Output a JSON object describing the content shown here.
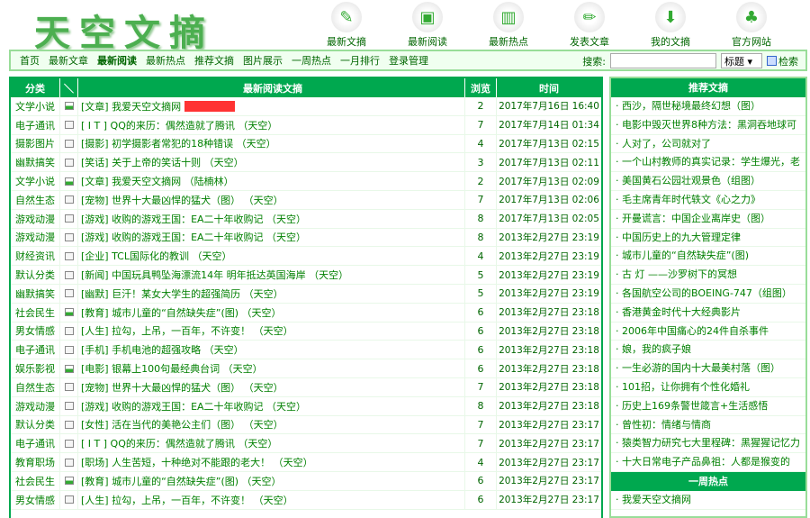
{
  "logo": "天空文摘",
  "topnav": [
    {
      "label": "最新文摘",
      "icon": "notepad-icon"
    },
    {
      "label": "最新阅读",
      "icon": "monitor-chart-icon"
    },
    {
      "label": "最新热点",
      "icon": "bar-chart-icon"
    },
    {
      "label": "发表文章",
      "icon": "pencil-icon"
    },
    {
      "label": "我的文摘",
      "icon": "download-folder-icon"
    },
    {
      "label": "官方网站",
      "icon": "bamboo-icon"
    }
  ],
  "nav": [
    "首页",
    "最新文章",
    "最新阅读",
    "最新热点",
    "推荐文摘",
    "图片展示",
    "一周热点",
    "一月排行",
    "登录管理"
  ],
  "search": {
    "label": "搜索:",
    "value": "",
    "select": "标题 ▾",
    "button": "检索"
  },
  "table": {
    "headers": [
      "分类",
      "＼",
      "最新阅读文摘",
      "浏览",
      "时间"
    ],
    "rows": [
      [
        "文学小说",
        "img",
        "[文章] 我爱天空文摘网",
        "2",
        "2017年7月16日 16:40"
      ],
      [
        "电子通讯",
        "doc",
        "[ I T ] QQ的来历：偶然造就了腾讯 （天空）",
        "7",
        "2017年7月14日 01:34"
      ],
      [
        "摄影图片",
        "doc",
        "[摄影] 初学摄影者常犯的18种错误 （天空）",
        "4",
        "2017年7月13日 02:15"
      ],
      [
        "幽默搞笑",
        "doc",
        "[笑话] 关于上帝的笑话十则 （天空）",
        "3",
        "2017年7月13日 02:11"
      ],
      [
        "文学小说",
        "img",
        "[文章] 我爱天空文摘网 （陆楠林）",
        "2",
        "2017年7月13日 02:09"
      ],
      [
        "自然生态",
        "doc",
        "[宠物] 世界十大最凶悍的猛犬（图） （天空）",
        "7",
        "2017年7月13日 02:06"
      ],
      [
        "游戏动漫",
        "doc",
        "[游戏] 收购的游戏王国：EA二十年收购记 （天空）",
        "8",
        "2017年7月13日 02:05"
      ],
      [
        "游戏动漫",
        "doc",
        "[游戏] 收购的游戏王国：EA二十年收购记 （天空）",
        "8",
        "2013年2月27日 23:19"
      ],
      [
        "财经资讯",
        "doc",
        "[企业] TCL国际化的教训 （天空）",
        "4",
        "2013年2月27日 23:19"
      ],
      [
        "默认分类",
        "doc",
        "[新闻] 中国玩具鸭坠海漂流14年 明年抵达英国海岸 （天空）",
        "5",
        "2013年2月27日 23:19"
      ],
      [
        "幽默搞笑",
        "doc",
        "[幽默] 巨汗！某女大学生的超强简历 （天空）",
        "5",
        "2013年2月27日 23:19"
      ],
      [
        "社会民生",
        "img",
        "[教育] 城市儿童的“自然缺失症”(图) （天空）",
        "6",
        "2013年2月27日 23:18"
      ],
      [
        "男女情感",
        "doc",
        "[人生] 拉勾，上吊，一百年，不许变！ （天空）",
        "6",
        "2013年2月27日 23:18"
      ],
      [
        "电子通讯",
        "doc",
        "[手机] 手机电池的超强攻略 （天空）",
        "6",
        "2013年2月27日 23:18"
      ],
      [
        "娱乐影视",
        "img",
        "[电影] 银幕上100句最经典台词 （天空）",
        "6",
        "2013年2月27日 23:18"
      ],
      [
        "自然生态",
        "doc",
        "[宠物] 世界十大最凶悍的猛犬（图） （天空）",
        "7",
        "2013年2月27日 23:18"
      ],
      [
        "游戏动漫",
        "doc",
        "[游戏] 收购的游戏王国：EA二十年收购记 （天空）",
        "8",
        "2013年2月27日 23:18"
      ],
      [
        "默认分类",
        "doc",
        "[女性] 活在当代的美艳公主们（图） （天空）",
        "7",
        "2013年2月27日 23:17"
      ],
      [
        "电子通讯",
        "doc",
        "[ I T ] QQ的来历：偶然造就了腾讯 （天空）",
        "7",
        "2013年2月27日 23:17"
      ],
      [
        "教育职场",
        "doc",
        "[职场] 人生苦短，十种绝对不能跟的老大！ （天空）",
        "4",
        "2013年2月27日 23:17"
      ],
      [
        "社会民生",
        "img",
        "[教育] 城市儿童的“自然缺失症”(图) （天空）",
        "6",
        "2013年2月27日 23:17"
      ],
      [
        "男女情感",
        "doc",
        "[人生] 拉勾，上吊，一百年，不许变！ （天空）",
        "6",
        "2013年2月27日 23:17"
      ]
    ]
  },
  "side": {
    "title": "推荐文摘",
    "items": [
      "西沙，隔世秘境最终幻想（图）",
      "电影中毁灭世界8种方法：黑洞吞地球可",
      "人对了，公司就对了",
      "一个山村教师的真实记录：学生爆光，老",
      "美国黄石公园壮观景色（组图）",
      "毛主席青年时代轶文《心之力》",
      "开曼谎言：中国企业离岸史（图）",
      "中国历史上的九大管理定律",
      "城市儿童的“自然缺失症”(图)",
      "古 灯 ——沙罗树下的冥想",
      "各国航空公司的BOEING-747（组图）",
      "香港黄金时代十大经典影片",
      "2006年中国痛心的24件自杀事件",
      "娘，我的疯子娘",
      "一生必游的国内十大最美村落（图）",
      "101招，让你拥有个性化婚礼",
      "历史上169条警世箴言+生活感悟",
      "曾性初：情绪与情商",
      "猿类智力研究七大里程碑：黑猩猩记忆力",
      "十大日常电子产品鼻祖：人都是猴变的"
    ],
    "week_title": "一周热点",
    "week_items": [
      "我爱天空文摘网"
    ]
  },
  "colors": {
    "accent": "#00a84f",
    "text": "#008000",
    "highlight": "#ff3333"
  }
}
